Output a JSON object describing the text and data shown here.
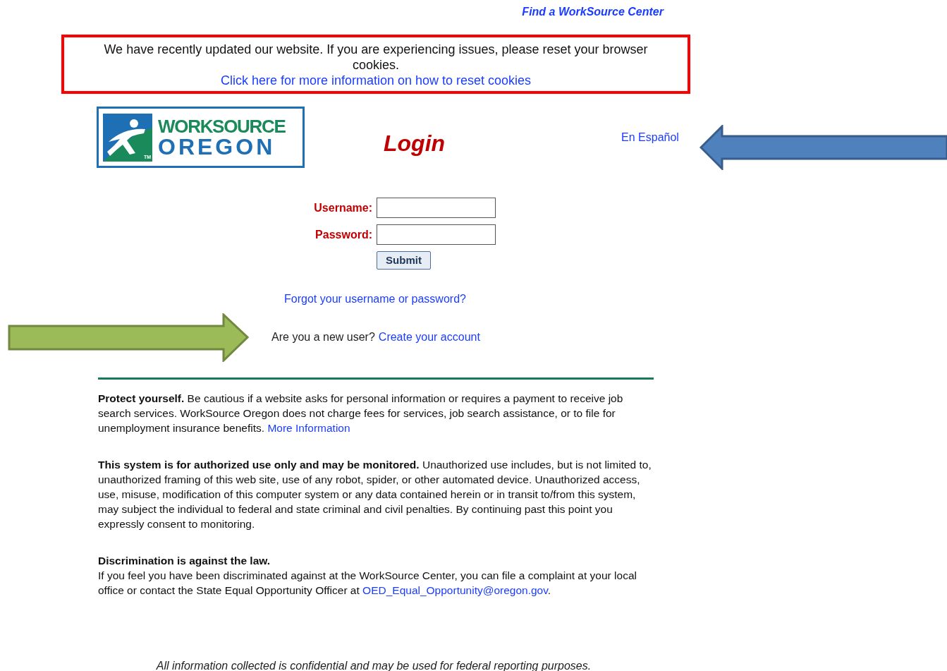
{
  "top_link": "Find a WorkSource Center",
  "notice": {
    "text": "We have recently updated our website. If you are experiencing issues, please reset your browser cookies.",
    "link": "Click here for more information on how to reset cookies"
  },
  "logo": {
    "line1": "WORKSOURCE",
    "line2": "OREGON",
    "tm": "TM"
  },
  "title": "Login",
  "language_link": "En Español",
  "form": {
    "fields": [
      {
        "label": "Username:"
      },
      {
        "label": "Password:"
      }
    ],
    "submit": "Submit"
  },
  "forgot_link": "Forgot your username or password?",
  "new_user": {
    "text": "Are you a new user?",
    "link": "Create your account"
  },
  "paragraphs": [
    {
      "text": "**Protect yourself.** Be cautious if a website asks for personal information or requires a payment to receive job search services. WorkSource Oregon does not charge fees for services, job search assistance, or to file for unemployment insurance benefits.",
      "link": "More Information"
    },
    {
      "text": "**This system is for authorized use only and may be monitored.** Unauthorized use includes, but is not limited to, unauthorized framing of this web site, use of any robot, spider, or other automated device. Unauthorized access, use, misuse, modification of this computer system or any data contained herein or in transit to/from this system, may subject the individual to federal and state criminal and civil penalties. By continuing past this point you expressly consent to monitoring."
    },
    {
      "heading": "Discrimination is against the law.",
      "text": "If you feel you have been discriminated against at the WorkSource Center, you can file a complaint at your local office or contact the State Equal Opportunity Officer at",
      "link": "OED_Equal_Opportunity@oregon.gov",
      "after": "."
    }
  ],
  "footer": "All information collected is confidential and may be used for federal reporting purposes."
}
